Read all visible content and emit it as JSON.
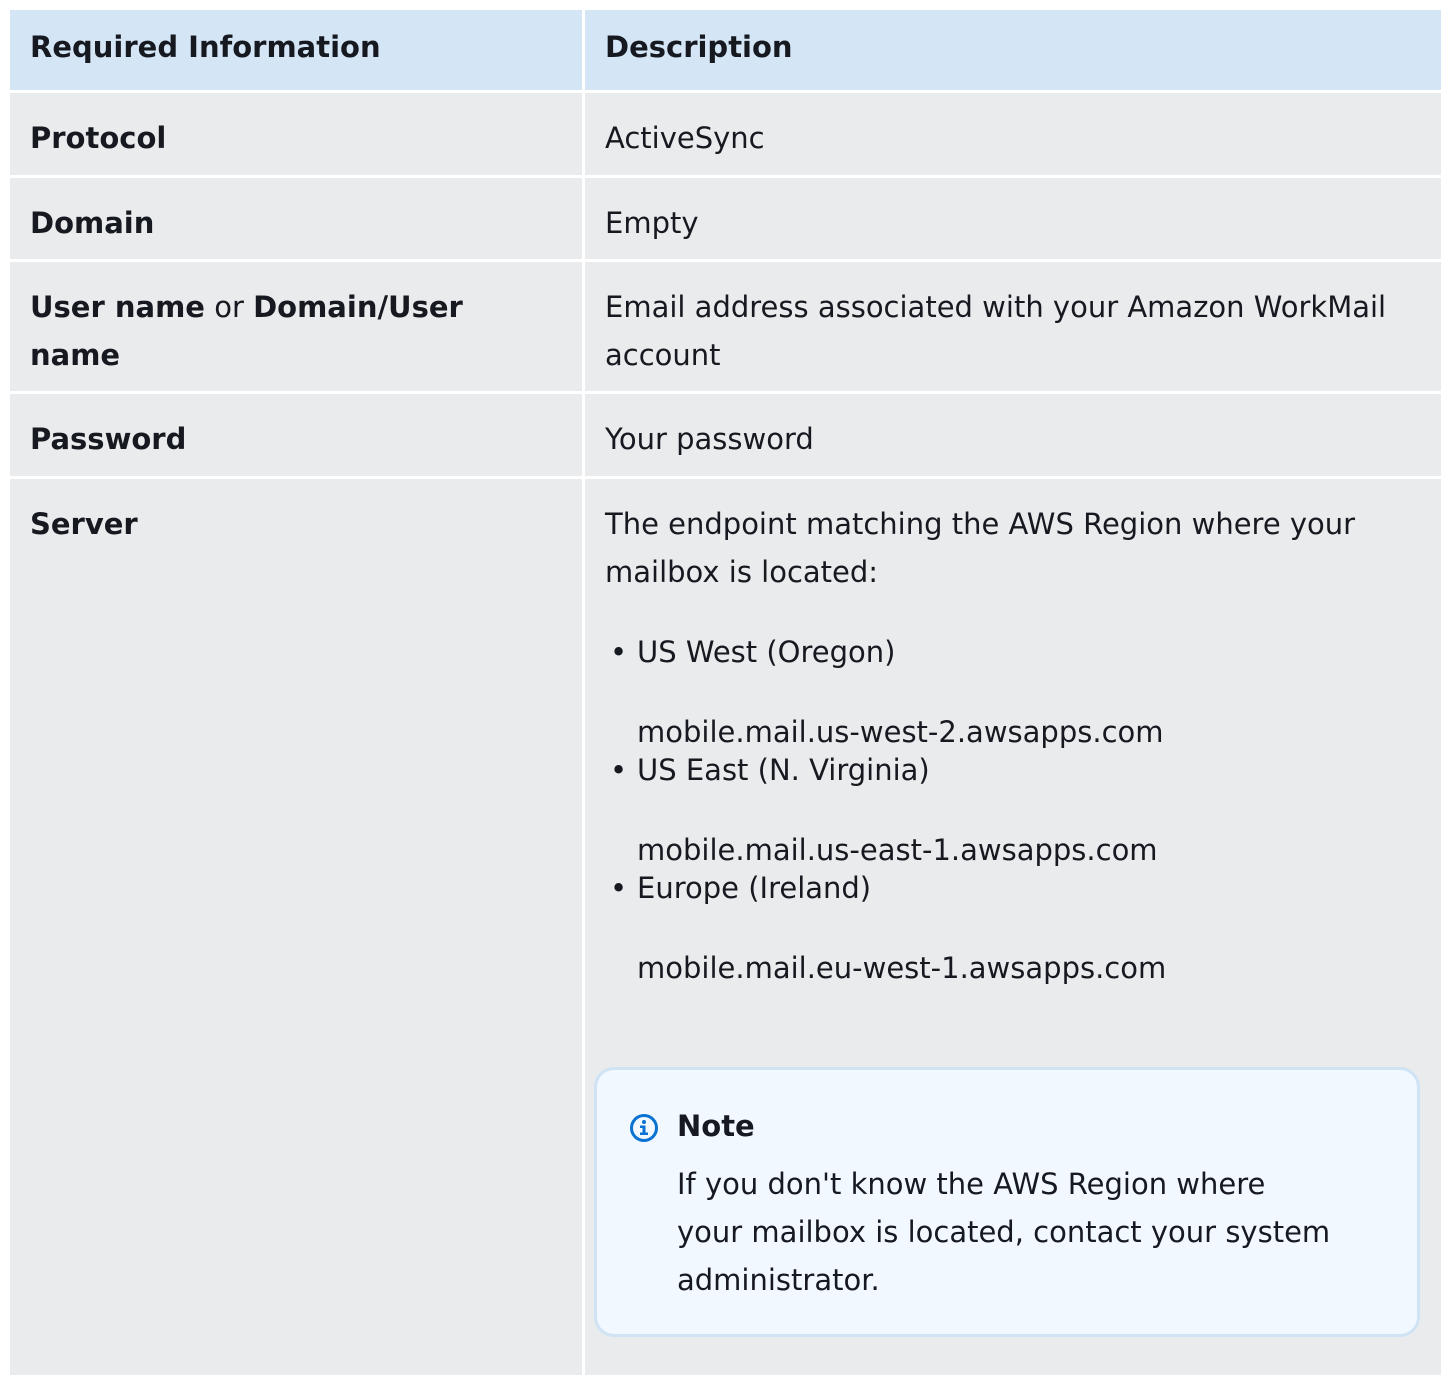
{
  "table": {
    "headers": [
      "Required Information",
      "Description"
    ],
    "rows": {
      "protocol": {
        "label": "Protocol",
        "value": "ActiveSync"
      },
      "domain": {
        "label": "Domain",
        "value": "Empty"
      },
      "user": {
        "label_bold_1": "User name",
        "label_connector": " or ",
        "label_bold_2": "Domain/User name",
        "value_line1": "Email address associated with your Amazon WorkMail",
        "value_line2": "account"
      },
      "password": {
        "label": "Password",
        "value": "Your password"
      },
      "server": {
        "label": "Server",
        "intro_line1": "The endpoint matching the AWS Region where your",
        "intro_line2": "mailbox is located:",
        "regions": [
          {
            "name": "US West (Oregon)",
            "endpoint": "mobile.mail.us-west-2.awsapps.com"
          },
          {
            "name": "US East (N. Virginia)",
            "endpoint": "mobile.mail.us-east-1.awsapps.com"
          },
          {
            "name": "Europe (Ireland)",
            "endpoint": "mobile.mail.eu-west-1.awsapps.com"
          }
        ]
      }
    }
  },
  "note": {
    "icon": "info-icon",
    "title": "Note",
    "text_line1": "If you don't know the AWS Region where",
    "text_line2": "your mailbox is located, contact your system",
    "text_line3": "administrator."
  },
  "colors": {
    "header_bg": "#d4e6f6",
    "row_bg": "#e9ebed",
    "note_bg": "#f1f8ff",
    "note_border": "#cfe3f5",
    "info_icon": "#0972d3"
  }
}
